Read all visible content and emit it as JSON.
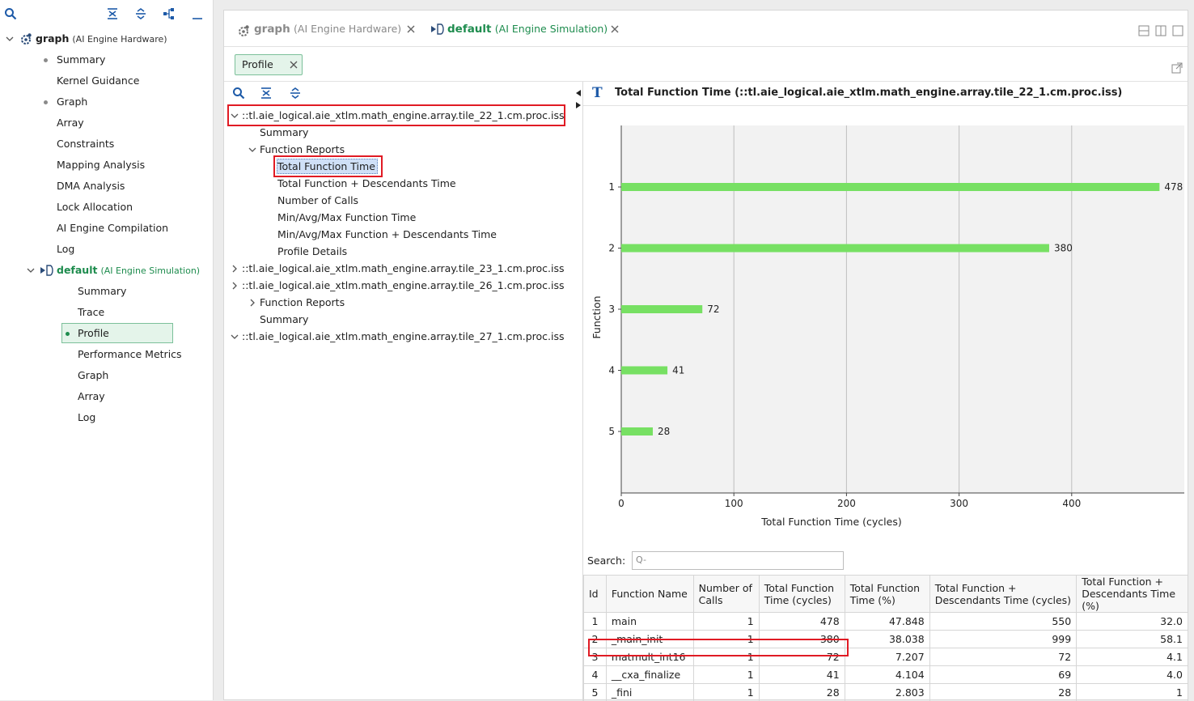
{
  "nav": {
    "toolbar": [
      "search-icon",
      "collapse-all-icon",
      "expand-all-icon",
      "hierarchy-icon",
      "minimize-icon"
    ],
    "graph": {
      "label": "graph",
      "context": "(AI Engine Hardware)"
    },
    "graph_items": [
      "Summary",
      "Kernel Guidance",
      "Graph",
      "Array",
      "Constraints",
      "Mapping Analysis",
      "DMA Analysis",
      "Lock Allocation",
      "AI Engine Compilation",
      "Log"
    ],
    "default": {
      "label": "default",
      "context": "(AI Engine Simulation)"
    },
    "default_items": [
      "Summary",
      "Trace",
      "Profile",
      "Performance Metrics",
      "Graph",
      "Array",
      "Log"
    ]
  },
  "tabs": [
    {
      "label": "graph",
      "context": "(AI Engine Hardware)"
    },
    {
      "label": "default",
      "context": "(AI Engine Simulation)"
    }
  ],
  "chip": {
    "label": "Profile"
  },
  "tree": {
    "tiles": [
      "::tl.aie_logical.aie_xtlm.math_engine.array.tile_22_1.cm.proc.iss",
      "::tl.aie_logical.aie_xtlm.math_engine.array.tile_23_1.cm.proc.iss",
      "::tl.aie_logical.aie_xtlm.math_engine.array.tile_26_1.cm.proc.iss",
      "::tl.aie_logical.aie_xtlm.math_engine.array.tile_27_1.cm.proc.iss"
    ],
    "summary": "Summary",
    "function_reports": "Function Reports",
    "reports": [
      "Total Function Time",
      "Total Function + Descendants Time",
      "Number of Calls",
      "Min/Avg/Max Function Time",
      "Min/Avg/Max Function + Descendants Time",
      "Profile Details"
    ]
  },
  "panel": {
    "title": "Total Function Time (::tl.aie_logical.aie_xtlm.math_engine.array.tile_22_1.cm.proc.iss)"
  },
  "chart_data": {
    "type": "bar",
    "orientation": "horizontal",
    "categories": [
      "1",
      "2",
      "3",
      "4",
      "5"
    ],
    "values": [
      478,
      380,
      72,
      41,
      28
    ],
    "xlabel": "Total Function Time (cycles)",
    "ylabel": "Function",
    "xticks": [
      0,
      100,
      200,
      300,
      400
    ],
    "xlim": [
      0,
      500
    ],
    "grid": true,
    "bar_color": "#77e063"
  },
  "search": {
    "label": "Search:",
    "placeholder": "Q-"
  },
  "table": {
    "headers": [
      "Id",
      "Function Name",
      "Number of Calls",
      "Total Function Time (cycles)",
      "Total Function Time (%)",
      "Total Function + Descendants Time (cycles)",
      "Total Function + Descendants Time (%)"
    ],
    "rows": [
      [
        "1",
        "main",
        "1",
        "478",
        "47.848",
        "550",
        "32.0"
      ],
      [
        "2",
        "_main_init",
        "1",
        "380",
        "38.038",
        "999",
        "58.1"
      ],
      [
        "3",
        "matmult_int16",
        "1",
        "72",
        "7.207",
        "72",
        "4.1"
      ],
      [
        "4",
        "__cxa_finalize",
        "1",
        "41",
        "4.104",
        "69",
        "4.0"
      ],
      [
        "5",
        "_fini",
        "1",
        "28",
        "2.803",
        "28",
        "1"
      ]
    ]
  },
  "colors": {
    "accent_green": "#1e8c4e",
    "highlight_red": "#e01b24",
    "selection_blue": "#cfe0f7"
  }
}
